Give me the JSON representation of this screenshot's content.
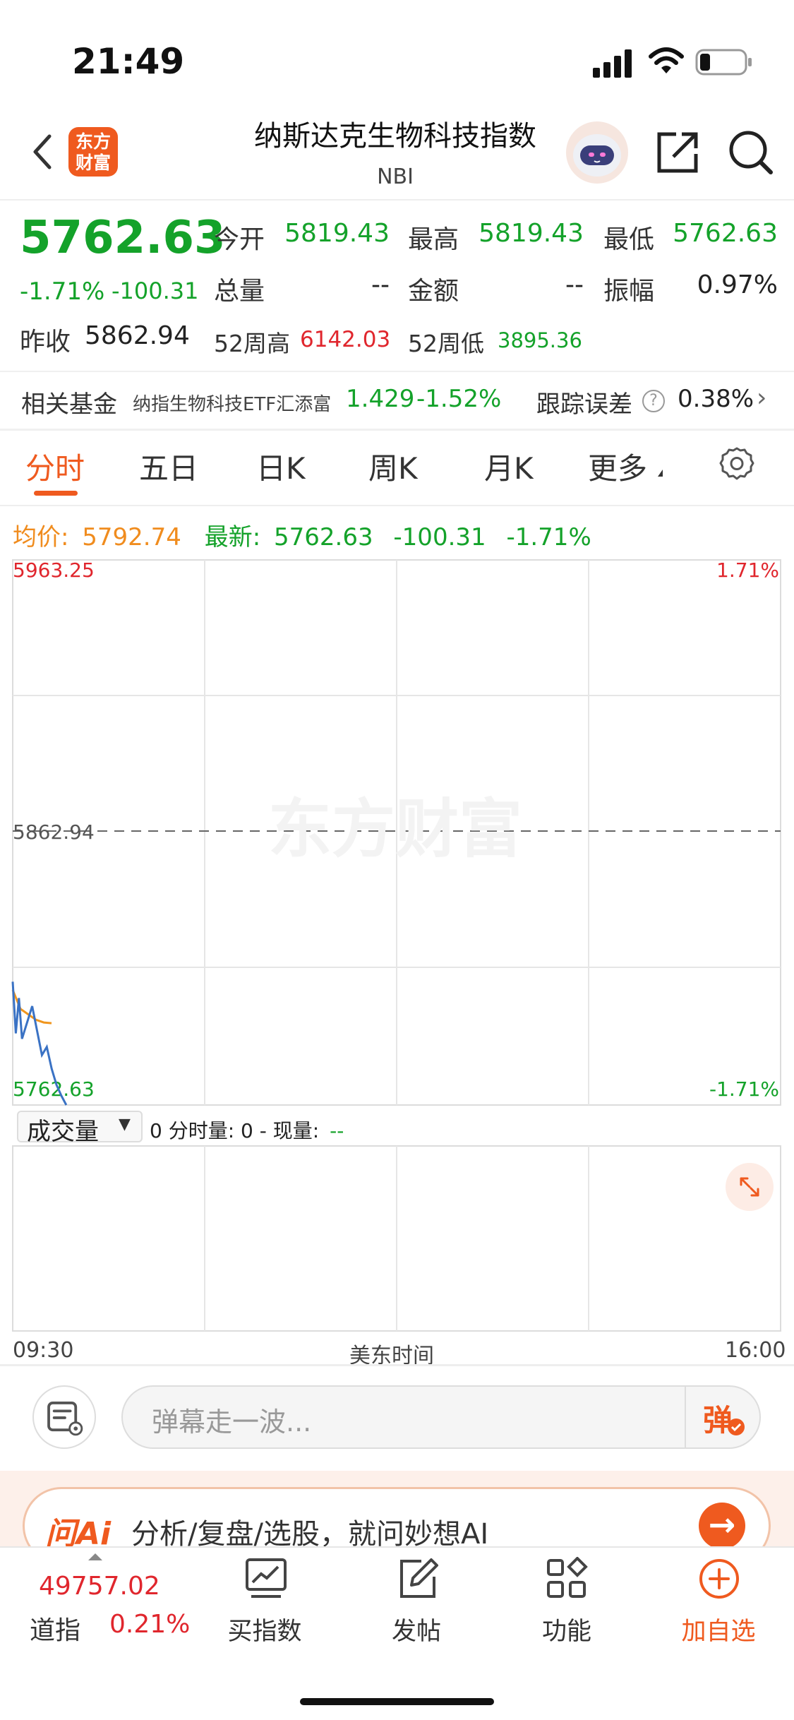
{
  "status": {
    "time": "21:49"
  },
  "header": {
    "logo_text_1": "东方",
    "logo_text_2": "财富",
    "title": "纳斯达克生物科技指数",
    "subtitle": "NBI"
  },
  "quote": {
    "price": "5762.63",
    "change_pct": "-1.71%",
    "change_abs": "-100.31",
    "open_label": "今开",
    "open": "5819.43",
    "high_label": "最高",
    "high": "5819.43",
    "low_label": "最低",
    "low": "5762.63",
    "volume_label": "总量",
    "volume": "--",
    "amount_label": "金额",
    "amount": "--",
    "amplitude_label": "振幅",
    "amplitude": "0.97%",
    "prev_close_label": "昨收",
    "prev_close": "5862.94",
    "w52_high_label": "52周高",
    "w52_high": "6142.03",
    "w52_low_label": "52周低",
    "w52_low": "3895.36"
  },
  "fund": {
    "label": "相关基金",
    "name": "纳指生物科技ETF汇添富",
    "price": "1.429",
    "change": "-1.52%",
    "tracking_label": "跟踪误差",
    "tracking_value": "0.38%"
  },
  "tabs": [
    {
      "label": "分时"
    },
    {
      "label": "五日"
    },
    {
      "label": "日K"
    },
    {
      "label": "周K"
    },
    {
      "label": "月K"
    },
    {
      "label": "更多"
    }
  ],
  "avg_row": {
    "avg_label": "均价:",
    "avg_value": "5792.74",
    "latest_label": "最新:",
    "latest_value": "5762.63",
    "latest_change": "-100.31",
    "latest_pct": "-1.71%"
  },
  "chart_data": {
    "type": "line",
    "y_max_label": "5963.25",
    "y_mid_label": "5862.94",
    "y_min_label": "5762.63",
    "right_max_label": "1.71%",
    "right_min_label": "-1.71%",
    "ylim": [
      5762.63,
      5963.25
    ],
    "reference_line": 5862.94,
    "x_start_label": "09:30",
    "x_mid_label": "美东时间",
    "x_end_label": "16:00",
    "watermark": "东方财富",
    "series": [
      {
        "name": "最新",
        "color": "#3a72c4",
        "values": [
          5808,
          5789,
          5802,
          5787,
          5799,
          5790,
          5781,
          5784,
          5776,
          5770,
          5766,
          5762.63
        ]
      },
      {
        "name": "均价",
        "color": "#f0961e",
        "values": [
          5805,
          5798,
          5796,
          5794,
          5793,
          5792.74
        ]
      }
    ]
  },
  "volume": {
    "select_label": "成交量",
    "info_text": "0 分时量: 0 - 现量:",
    "info_dash": "--"
  },
  "danmu": {
    "placeholder": "弹幕走一波...",
    "button": "弹"
  },
  "ai": {
    "logo": "问Ai",
    "text": "分析/复盘/选股，就问妙想AI"
  },
  "bottom_nav": {
    "index_value": "49757.02",
    "index_name": "道指",
    "index_pct": "0.21%",
    "items": [
      {
        "label": "买指数"
      },
      {
        "label": "发帖"
      },
      {
        "label": "功能"
      },
      {
        "label": "加自选"
      }
    ]
  },
  "colors": {
    "accent": "#ef5a1f",
    "up": "#e0262d",
    "down": "#14a22a",
    "avg": "#f08c1e",
    "line": "#3a72c4"
  }
}
